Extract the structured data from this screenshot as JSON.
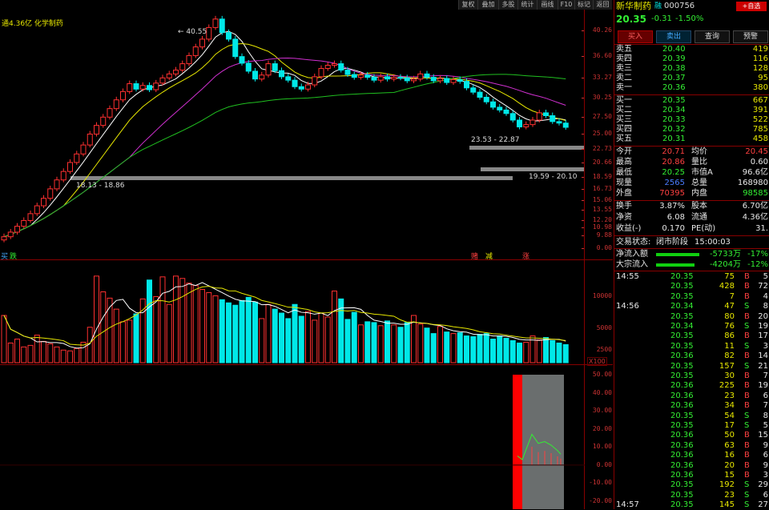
{
  "toolbar": {
    "buttons": [
      "复权",
      "叠加",
      "多股",
      "统计",
      "画线",
      "F10",
      "标记",
      "返回"
    ]
  },
  "chart": {
    "info": "通4.36亿 化学制药",
    "high_label": "40.55",
    "box1_label": "23.53 - 22.87",
    "box2_label": "19.59 - 20.10",
    "support_label": "18.13 - 18.86",
    "price_axis": [
      "40.26",
      "36.60",
      "33.27",
      "30.25",
      "27.50",
      "25.00",
      "22.73",
      "20.66",
      "18.59",
      "16.73",
      "15.06",
      "13.55",
      "12.20",
      "10.98",
      "9.88",
      "0.00"
    ],
    "volume_axis": [
      "10000",
      "5000",
      "2500"
    ],
    "volume_unit": "X100",
    "indicator_axis": [
      "50.00",
      "40.00",
      "30.00",
      "20.00",
      "10.00",
      "0.00",
      "-10.00",
      "-20.00"
    ],
    "signals": {
      "left_buy": "买",
      "left_sell": "跌",
      "right_buy": "赌",
      "right_mid": "减",
      "right_sell": "涨"
    }
  },
  "stock": {
    "name": "新华制药",
    "tag": "融",
    "code": "000756",
    "price": "20.35",
    "change": "-0.31",
    "pct": "-1.50%",
    "add_btn": "+自选"
  },
  "actions": {
    "buy": "买入",
    "sell": "卖出",
    "query": "查询",
    "alert": "预警"
  },
  "sells": [
    {
      "label": "卖五",
      "price": "20.40",
      "vol": "419"
    },
    {
      "label": "卖四",
      "price": "20.39",
      "vol": "116"
    },
    {
      "label": "卖三",
      "price": "20.38",
      "vol": "128"
    },
    {
      "label": "卖二",
      "price": "20.37",
      "vol": "95"
    },
    {
      "label": "卖一",
      "price": "20.36",
      "vol": "380"
    }
  ],
  "buys": [
    {
      "label": "买一",
      "price": "20.35",
      "vol": "667"
    },
    {
      "label": "买二",
      "price": "20.34",
      "vol": "391"
    },
    {
      "label": "买三",
      "price": "20.33",
      "vol": "522"
    },
    {
      "label": "买四",
      "price": "20.32",
      "vol": "785"
    },
    {
      "label": "买五",
      "price": "20.31",
      "vol": "458"
    }
  ],
  "stats": [
    {
      "l1": "今开",
      "v1": "20.71",
      "l2": "均价",
      "v2": "20.45"
    },
    {
      "l1": "最高",
      "v1": "20.86",
      "l2": "量比",
      "v2": "0.60"
    },
    {
      "l1": "最低",
      "v1": "20.25",
      "l2": "市值A",
      "v2": "96.6亿"
    },
    {
      "l1": "现量",
      "v1": "2565",
      "l2": "总量",
      "v2": "168980"
    },
    {
      "l1": "外盘",
      "v1": "70395",
      "l2": "内盘",
      "v2": "98585"
    }
  ],
  "fund": [
    {
      "l1": "换手",
      "v1": "3.87%",
      "l2": "股本",
      "v2": "6.70亿"
    },
    {
      "l1": "净资",
      "v1": "6.08",
      "l2": "流通",
      "v2": "4.36亿"
    },
    {
      "l1": "收益(-)",
      "v1": "0.170",
      "l2": "PE(动)",
      "v2": "31."
    }
  ],
  "status": {
    "label": "交易状态:",
    "value": "闭市阶段",
    "time": "15:00:03"
  },
  "flow": [
    {
      "label": "净流入额",
      "amount": "-5733万",
      "pct": "-17%"
    },
    {
      "label": "大宗流入",
      "amount": "-4204万",
      "pct": "-12%"
    }
  ],
  "ticks": [
    {
      "time": "14:55",
      "price": "20.35",
      "vol": "75",
      "bs": "B",
      "n": "5"
    },
    {
      "time": "",
      "price": "20.35",
      "vol": "428",
      "bs": "B",
      "n": "72"
    },
    {
      "time": "",
      "price": "20.35",
      "vol": "7",
      "bs": "B",
      "n": "4"
    },
    {
      "time": "14:56",
      "price": "20.34",
      "vol": "47",
      "bs": "S",
      "n": "8"
    },
    {
      "time": "",
      "price": "20.35",
      "vol": "80",
      "bs": "B",
      "n": "20"
    },
    {
      "time": "",
      "price": "20.34",
      "vol": "76",
      "bs": "S",
      "n": "19"
    },
    {
      "time": "",
      "price": "20.35",
      "vol": "86",
      "bs": "B",
      "n": "17"
    },
    {
      "time": "",
      "price": "20.35",
      "vol": "11",
      "bs": "S",
      "n": "3"
    },
    {
      "time": "",
      "price": "20.36",
      "vol": "82",
      "bs": "B",
      "n": "14"
    },
    {
      "time": "",
      "price": "20.35",
      "vol": "157",
      "bs": "S",
      "n": "21"
    },
    {
      "time": "",
      "price": "20.35",
      "vol": "30",
      "bs": "B",
      "n": "7"
    },
    {
      "time": "",
      "price": "20.36",
      "vol": "225",
      "bs": "B",
      "n": "19"
    },
    {
      "time": "",
      "price": "20.36",
      "vol": "23",
      "bs": "B",
      "n": "6"
    },
    {
      "time": "",
      "price": "20.36",
      "vol": "34",
      "bs": "B",
      "n": "7"
    },
    {
      "time": "",
      "price": "20.35",
      "vol": "54",
      "bs": "S",
      "n": "8"
    },
    {
      "time": "",
      "price": "20.35",
      "vol": "17",
      "bs": "S",
      "n": "5"
    },
    {
      "time": "",
      "price": "20.36",
      "vol": "50",
      "bs": "B",
      "n": "15"
    },
    {
      "time": "",
      "price": "20.36",
      "vol": "63",
      "bs": "B",
      "n": "9"
    },
    {
      "time": "",
      "price": "20.36",
      "vol": "16",
      "bs": "B",
      "n": "6"
    },
    {
      "time": "",
      "price": "20.36",
      "vol": "20",
      "bs": "B",
      "n": "9"
    },
    {
      "time": "",
      "price": "20.36",
      "vol": "15",
      "bs": "B",
      "n": "3"
    },
    {
      "time": "",
      "price": "20.35",
      "vol": "192",
      "bs": "S",
      "n": "29"
    },
    {
      "time": "",
      "price": "20.35",
      "vol": "23",
      "bs": "S",
      "n": "6"
    },
    {
      "time": "14:57",
      "price": "20.35",
      "vol": "145",
      "bs": "S",
      "n": "27"
    }
  ],
  "chart_data": {
    "type": "candlestick",
    "ylim": [
      9.88,
      40.26
    ],
    "close": [
      10.2,
      10.5,
      10.9,
      11.3,
      11.8,
      12.4,
      13.0,
      13.8,
      14.6,
      15.4,
      16.3,
      17.2,
      18.2,
      19.5,
      20.6,
      21.7,
      22.9,
      24.2,
      25.5,
      26.8,
      25.9,
      26.5,
      25.8,
      26.9,
      27.8,
      28.5,
      29.2,
      30.4,
      32.0,
      33.8,
      35.5,
      38.2,
      40.3,
      37.0,
      35.5,
      31.8,
      30.5,
      29.0,
      27.6,
      28.3,
      30.4,
      29.1,
      28.0,
      27.4,
      26.3,
      25.9,
      26.6,
      28.0,
      29.5,
      30.1,
      30.4,
      29.2,
      28.4,
      27.9,
      28.3,
      27.9,
      27.4,
      28.0,
      27.6,
      27.9,
      27.8,
      27.3,
      27.6,
      28.5,
      27.9,
      27.3,
      27.7,
      27.0,
      27.5,
      27.2,
      26.1,
      25.4,
      24.6,
      23.9,
      23.1,
      22.7,
      22.2,
      21.3,
      20.4,
      20.7,
      21.3,
      22.3,
      21.9,
      21.1,
      20.9,
      20.35
    ],
    "volume": [
      6000,
      2500,
      3000,
      2000,
      2200,
      3500,
      2700,
      2400,
      2000,
      1600,
      1500,
      1800,
      2600,
      4500,
      11000,
      9000,
      8200,
      6800,
      5200,
      5400,
      6200,
      8100,
      10500,
      8400,
      10900,
      7400,
      11000,
      10700,
      10100,
      9800,
      9300,
      8900,
      8500,
      8000,
      7600,
      7300,
      7900,
      8300,
      7700,
      5600,
      7400,
      6800,
      6300,
      5600,
      7400,
      5900,
      6500,
      5400,
      6300,
      5800,
      9100,
      8100,
      5500,
      6400,
      4800,
      5200,
      5100,
      4700,
      5300,
      4800,
      4500,
      5100,
      6000,
      4900,
      4400,
      3700,
      4600,
      3900,
      3700,
      3800,
      3400,
      3300,
      3600,
      3700,
      3000,
      3400,
      3100,
      2800,
      2500,
      2600,
      3400,
      2900,
      3200,
      2800,
      2500,
      2300
    ],
    "indicator_last": [
      5,
      3,
      17,
      12,
      13,
      11,
      8,
      6
    ],
    "indicator_ylim": [
      -20,
      50
    ]
  }
}
